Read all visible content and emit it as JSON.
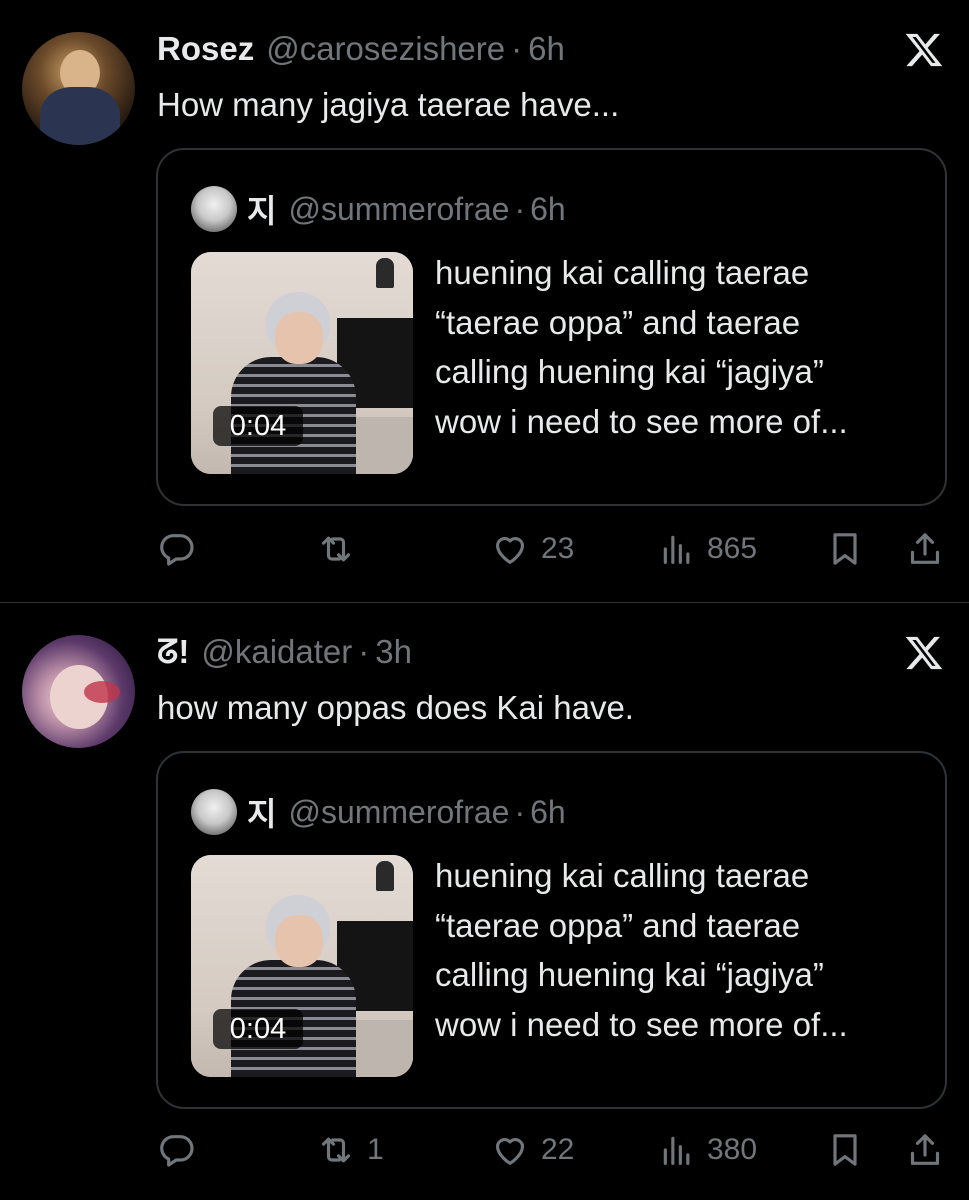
{
  "tweets": [
    {
      "name": "Rosez",
      "handle": "@carosezishere",
      "separator": "·",
      "time": "6h",
      "text": "How many jagiya taerae have...",
      "quote": {
        "name": "지",
        "handle": "@summerofrae",
        "separator": "·",
        "time": "6h",
        "video_duration": "0:04",
        "text_lines": [
          "huening kai calling taerae",
          "“taerae oppa” and taerae",
          "calling huening kai “jagiya”",
          "wow i need to see more of..."
        ]
      },
      "actions": {
        "reply": "",
        "retweet": "",
        "like": "23",
        "views": "865"
      }
    },
    {
      "name": "ᘔ!",
      "handle": "@kaidater",
      "separator": "·",
      "time": "3h",
      "text": "how many oppas does Kai have.",
      "quote": {
        "name": "지",
        "handle": "@summerofrae",
        "separator": "·",
        "time": "6h",
        "video_duration": "0:04",
        "text_lines": [
          "huening kai calling taerae",
          "“taerae oppa” and taerae",
          "calling huening kai “jagiya”",
          "wow i need to see more of..."
        ]
      },
      "actions": {
        "reply": "",
        "retweet": "1",
        "like": "22",
        "views": "380"
      }
    }
  ],
  "icons": {
    "reply": "reply-icon",
    "retweet": "retweet-icon",
    "like": "heart-icon",
    "views": "views-icon",
    "bookmark": "bookmark-icon",
    "share": "share-icon",
    "brand": "x-logo-icon"
  },
  "colors": {
    "background": "#000000",
    "text": "#e7e9ea",
    "secondary": "#71767b",
    "border": "#2f3336"
  }
}
